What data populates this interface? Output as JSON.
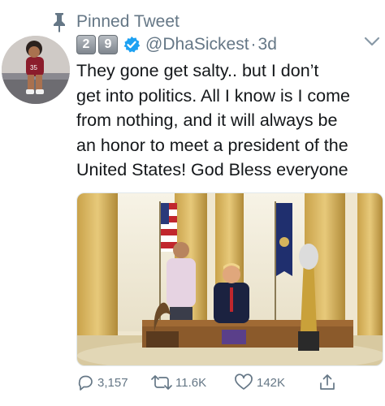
{
  "pinned": {
    "label": "Pinned Tweet"
  },
  "author": {
    "badge_digits": [
      "2",
      "9"
    ],
    "handle": "@DhaSickest",
    "separator": "·",
    "time": "3d"
  },
  "tweet": {
    "lines": [
      "They gone get salty.. but I don’t",
      "get into politics. All I know is I come",
      "from nothing, and it will always be",
      "an honor to meet a president of the",
      "United States! God Bless everyone"
    ]
  },
  "actions": {
    "replies": "3,157",
    "retweets": "11.6K",
    "likes": "142K"
  },
  "colors": {
    "secondary_text": "#657786",
    "verified_blue": "#1da1f2",
    "primary_text": "#14171a"
  },
  "icons": [
    "pin-icon",
    "verified-badge-icon",
    "chevron-down-icon",
    "reply-icon",
    "retweet-icon",
    "like-icon",
    "share-icon"
  ]
}
